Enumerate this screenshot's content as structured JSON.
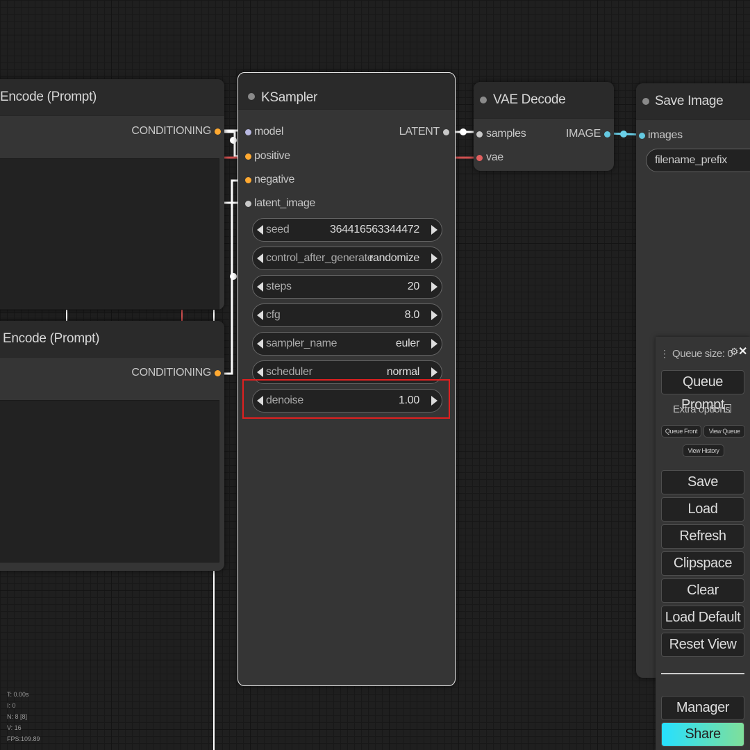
{
  "nodes": {
    "clip_top": {
      "title": "t Encode (Prompt)",
      "output_label": "CONDITIONING"
    },
    "clip_bottom": {
      "title": "Encode (Prompt)",
      "output_label": "CONDITIONING"
    },
    "ksampler": {
      "title": "KSampler",
      "inputs": [
        "model",
        "positive",
        "negative",
        "latent_image"
      ],
      "output_label": "LATENT",
      "widgets": [
        {
          "name": "seed",
          "value": "364416563344472"
        },
        {
          "name": "control_after_generate",
          "value": "randomize"
        },
        {
          "name": "steps",
          "value": "20"
        },
        {
          "name": "cfg",
          "value": "8.0"
        },
        {
          "name": "sampler_name",
          "value": "euler"
        },
        {
          "name": "scheduler",
          "value": "normal"
        },
        {
          "name": "denoise",
          "value": "1.00"
        }
      ]
    },
    "vae_decode": {
      "title": "VAE Decode",
      "inputs": [
        "samples",
        "vae"
      ],
      "output_label": "IMAGE"
    },
    "save_image": {
      "title": "Save Image",
      "input_label": "images",
      "widget_label": "filename_prefix"
    }
  },
  "menu": {
    "queue_size_label": "Queue size: 0",
    "queue_prompt": "Queue Prompt",
    "extra_options": "Extra options",
    "queue_front": "Queue Front",
    "view_queue": "View Queue",
    "view_history": "View History",
    "save": "Save",
    "load": "Load",
    "refresh": "Refresh",
    "clipspace": "Clipspace",
    "clear": "Clear",
    "load_default": "Load Default",
    "reset_view": "Reset View",
    "manager": "Manager",
    "share": "Share"
  },
  "stats": [
    "T: 0.00s",
    "I: 0",
    "N: 8 [8]",
    "V: 16",
    "FPS:109.89"
  ],
  "colors": {
    "canvas": "#1f1f1f",
    "node": "#353535",
    "model_slot": "#b8b8e0",
    "conditioning": "#ffa931",
    "latent": "#ff9cf9",
    "vae": "#e06060",
    "image": "#64b5f6",
    "highlight": "#e02020",
    "share_gradient_start": "#26e0ff",
    "share_gradient_end": "#7fdf9a"
  }
}
